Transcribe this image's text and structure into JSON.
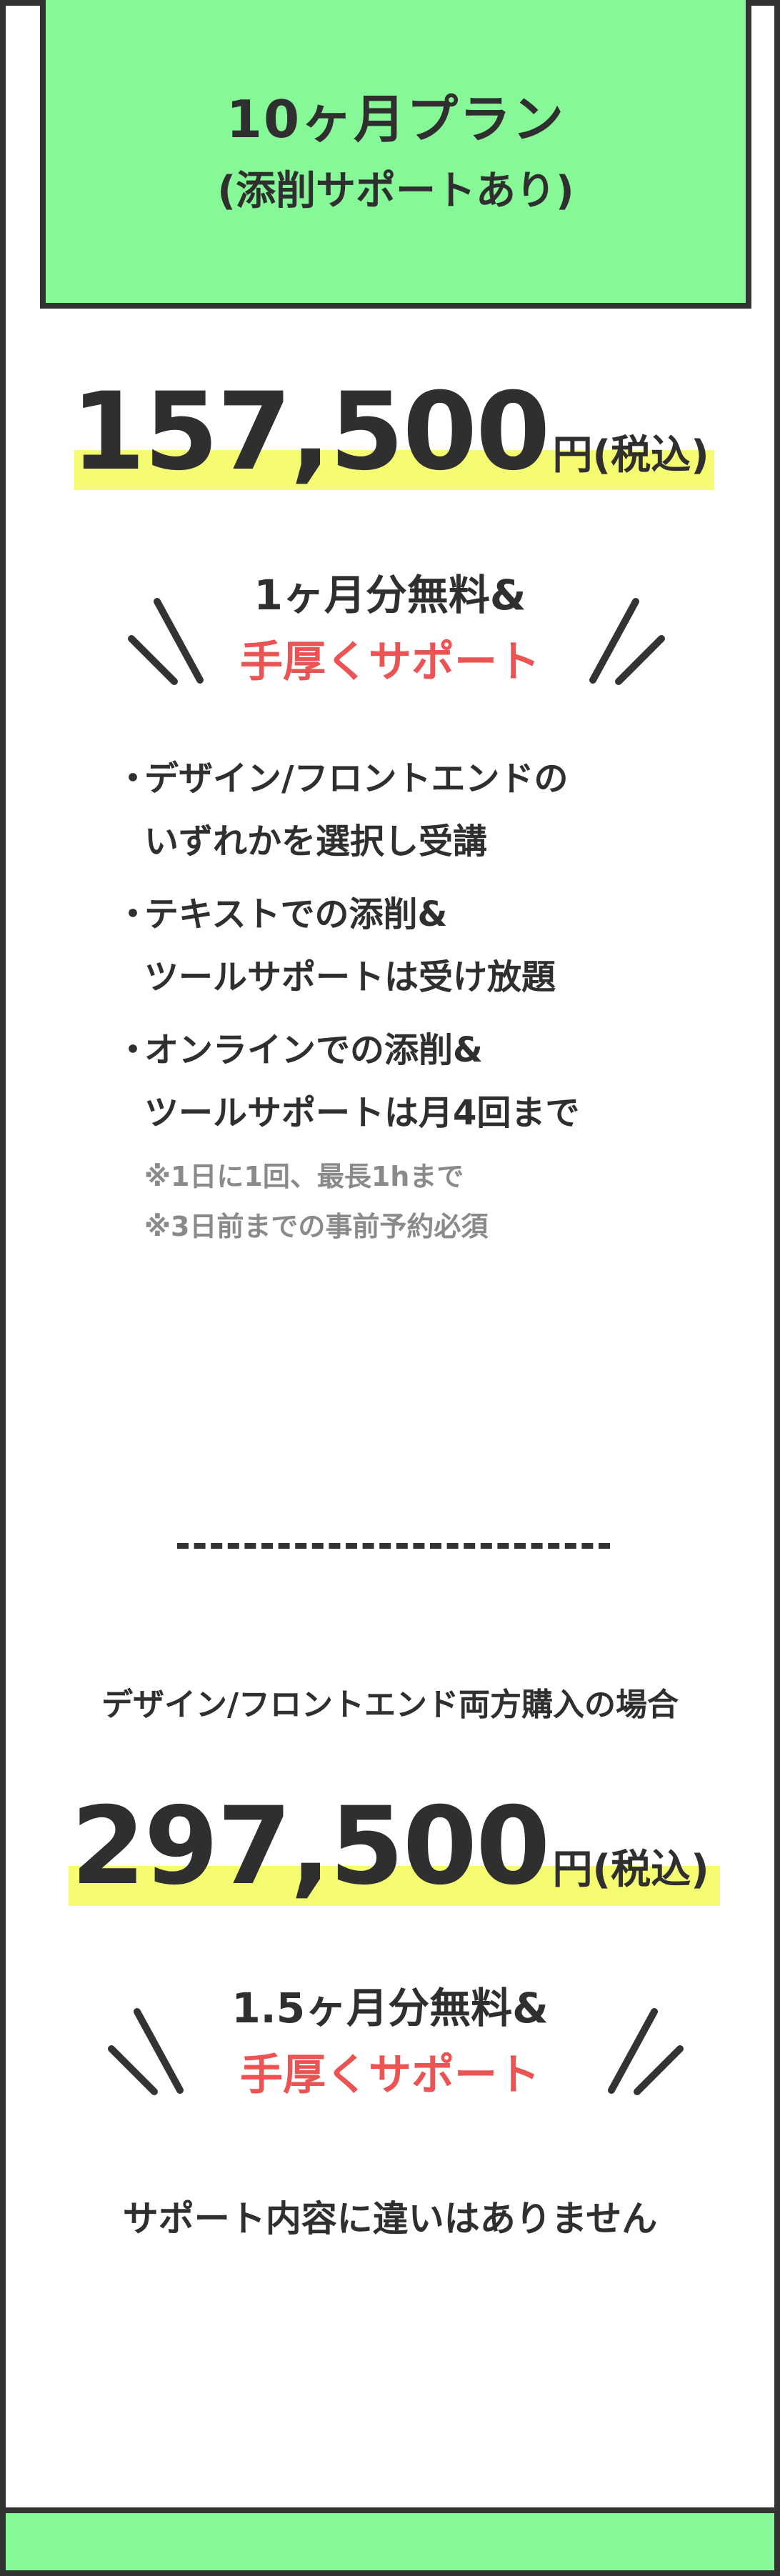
{
  "header": {
    "title": "10ヶ月プラン",
    "subtitle": "(添削サポートあり)"
  },
  "plan_single": {
    "price": "157,500",
    "unit": "円(税込)",
    "benefit_line1": "1ヶ月分無料&",
    "benefit_line2": "手厚くサポート",
    "features": [
      {
        "bullet": "・",
        "line1": "デザイン/フロントエンドの",
        "line2": "いずれかを選択し受講"
      },
      {
        "bullet": "・",
        "line1": "テキストでの添削&",
        "line2": "ツールサポートは受け放題"
      },
      {
        "bullet": "・",
        "line1": "オンラインでの添削&",
        "line2": "ツールサポートは月4回まで"
      }
    ],
    "notes": [
      "※1日に1回、最長1hまで",
      "※3日前までの事前予約必須"
    ]
  },
  "plan_both": {
    "label": "デザイン/フロントエンド両方購入の場合",
    "price": "297,500",
    "unit": "円(税込)",
    "benefit_line1": "1.5ヶ月分無料&",
    "benefit_line2": "手厚くサポート",
    "same_support": "サポート内容に違いはありません"
  },
  "colors": {
    "accent_green": "#86f898",
    "highlight_yellow": "#f6fc72",
    "emphasis_red": "#ec5353",
    "text_dark": "#2f2f2f",
    "note_gray": "#8a8a8a"
  }
}
